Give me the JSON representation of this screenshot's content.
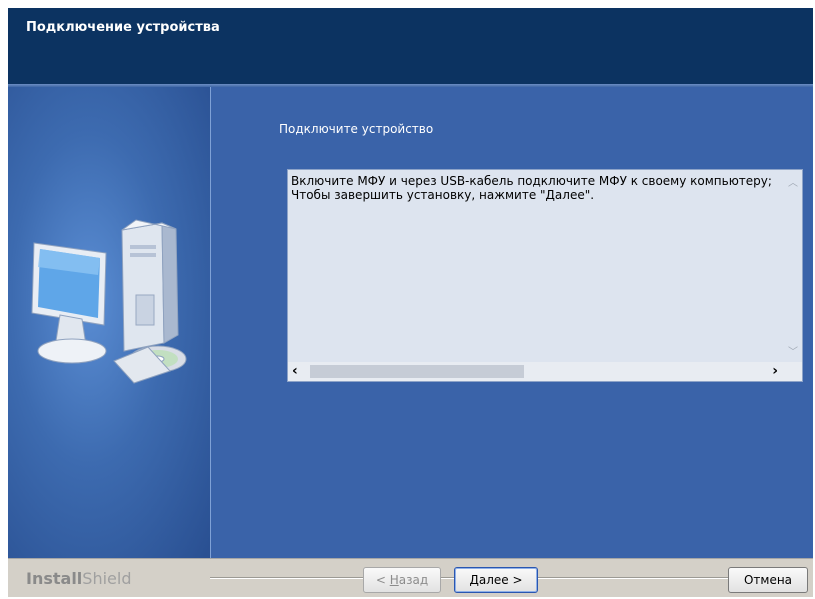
{
  "window": {
    "title": "Подключение устройства"
  },
  "main": {
    "subtitle": "Подключите устройство",
    "text_lines": [
      "Включите МФУ и через USB-кабель подключите МФУ к своему компьютеру; по",
      "Чтобы завершить установку, нажмите \"Далее\"."
    ],
    "text_scroll": {
      "horizontal_thumb_fraction": 0.45
    }
  },
  "footer": {
    "brand_bold": "Install",
    "brand_light": "Shield",
    "back_prefix": "< ",
    "back_mnemonic": "Н",
    "back_rest": "азад",
    "next_mnemonic": "Д",
    "next_rest": "алее >",
    "cancel_label": "Отмена"
  },
  "icons": {
    "scroll_up": "chevron-up-icon",
    "scroll_down": "chevron-down-icon",
    "scroll_left": "chevron-left-icon",
    "scroll_right": "chevron-right-icon",
    "illustration": "computer-with-cd-icon"
  },
  "colors": {
    "header_bg": "#0c3361",
    "panel_bg": "#3a63a9",
    "textbox_bg": "#dde4ef"
  }
}
